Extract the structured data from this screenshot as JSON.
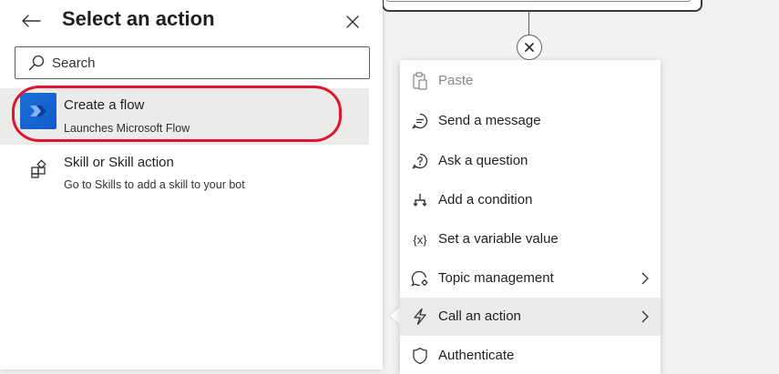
{
  "panel": {
    "title": "Select an action",
    "search": {
      "placeholder": "Search",
      "value": ""
    },
    "actions": [
      {
        "title": "Create a flow",
        "description": "Launches Microsoft Flow",
        "icon": "power-automate-icon",
        "selected": true
      },
      {
        "title": "Skill or Skill action",
        "description": "Go to Skills to add a skill to your bot",
        "icon": "skill-icon",
        "selected": false
      }
    ]
  },
  "context_menu": {
    "items": [
      {
        "label": "Paste",
        "icon": "paste-icon",
        "disabled": true,
        "submenu": false
      },
      {
        "label": "Send a message",
        "icon": "message-icon",
        "disabled": false,
        "submenu": false
      },
      {
        "label": "Ask a question",
        "icon": "question-icon",
        "disabled": false,
        "submenu": false
      },
      {
        "label": "Add a condition",
        "icon": "branch-icon",
        "disabled": false,
        "submenu": false
      },
      {
        "label": "Set a variable value",
        "icon": "variable-icon",
        "icon_glyph": "{x}",
        "disabled": false,
        "submenu": false
      },
      {
        "label": "Topic management",
        "icon": "topic-management-icon",
        "disabled": false,
        "submenu": true
      },
      {
        "label": "Call an action",
        "icon": "lightning-icon",
        "disabled": false,
        "submenu": true,
        "active": true
      },
      {
        "label": "Authenticate",
        "icon": "shield-icon",
        "disabled": false,
        "submenu": false
      }
    ]
  },
  "colors": {
    "accent_blue": "#0f5bcc",
    "highlight_red": "#e0142c",
    "selected_bg": "#edebe9",
    "canvas_bg": "#f3f2f1"
  }
}
